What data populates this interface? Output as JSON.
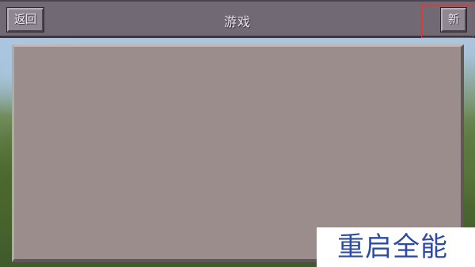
{
  "header": {
    "title": "游戏",
    "back_label": "返回",
    "new_label": "新"
  },
  "watermark": {
    "text": "重启全能"
  },
  "colors": {
    "top_bar": "#716a74",
    "panel": "#9a8d8c",
    "button": "#8f8791",
    "highlight_frame": "#d63a3a",
    "watermark_text": "#2d4aa6"
  }
}
